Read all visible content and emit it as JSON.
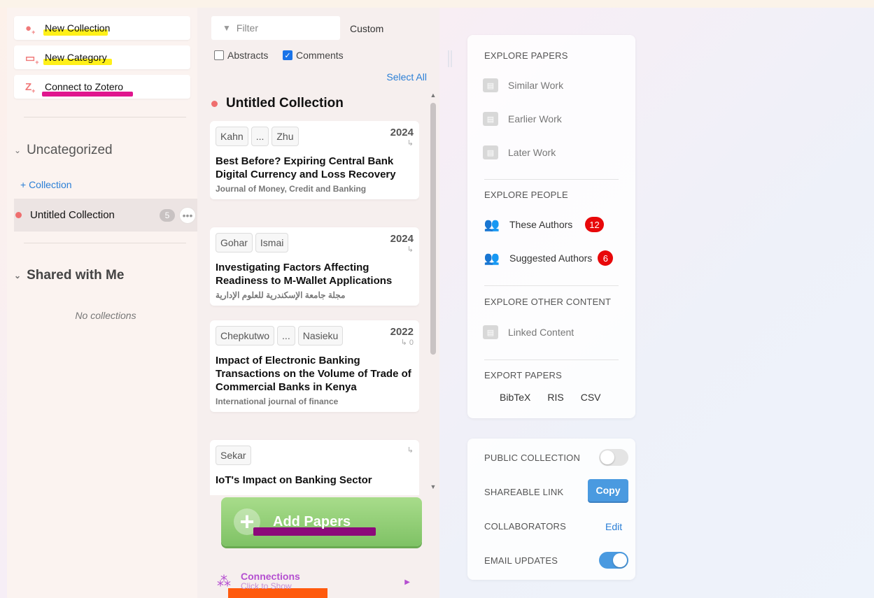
{
  "sidebar": {
    "actions": [
      {
        "label": "New Collection",
        "icon": "new-collection-icon"
      },
      {
        "label": "New Category",
        "icon": "new-category-icon"
      },
      {
        "label": "Connect to Zotero",
        "icon": "zotero-icon"
      }
    ],
    "uncategorized": "Uncategorized",
    "add_collection": "+ Collection",
    "collection": {
      "name": "Untitled Collection",
      "count": "5",
      "more": "•••"
    },
    "shared": "Shared with Me",
    "no_collections": "No collections"
  },
  "middle": {
    "filter_placeholder": "Filter",
    "sort": "Custom",
    "abstracts_label": "Abstracts",
    "comments_label": "Comments",
    "abstracts_checked": false,
    "comments_checked": true,
    "select_all": "Select All",
    "collection_title": "Untitled Collection",
    "papers": [
      {
        "authors": [
          "Kahn",
          "...",
          "Zhu"
        ],
        "year": "2024",
        "cites": "↳",
        "title": "Best Before? Expiring Central Bank Digital Currency and Loss Recovery",
        "journal": "Journal of Money, Credit and Banking"
      },
      {
        "authors": [
          "Gohar",
          "Ismai"
        ],
        "year": "2024",
        "cites": "↳",
        "title": "Investigating Factors Affecting Readiness to M-Wallet Applications",
        "journal": "مجلة جامعة الإسكندرية للعلوم الإدارية"
      },
      {
        "authors": [
          "Chepkutwo",
          "...",
          "Nasieku"
        ],
        "year": "2022",
        "cites": "↳ 0",
        "title": "Impact of Electronic Banking Transactions on the Volume of Trade of Commercial Banks in Kenya",
        "journal": "International journal of finance"
      },
      {
        "authors": [
          "Sekar"
        ],
        "year": "",
        "cites": "↳",
        "title": "IoT's Impact on Banking Sector",
        "journal": ""
      }
    ],
    "add_papers": "Add Papers",
    "connections": "Connections",
    "connections_sub": "Click to Show"
  },
  "explore": {
    "papers_head": "EXPLORE PAPERS",
    "similar": "Similar Work",
    "earlier": "Earlier Work",
    "later": "Later Work",
    "people_head": "EXPLORE PEOPLE",
    "these_authors": "These Authors",
    "these_count": "12",
    "suggested_authors": "Suggested Authors",
    "suggested_count": "6",
    "other_head": "EXPLORE OTHER CONTENT",
    "linked": "Linked Content",
    "export_head": "EXPORT PAPERS",
    "bibtex": "BibTeX",
    "ris": "RIS",
    "csv": "CSV"
  },
  "settings": {
    "public": "PUBLIC COLLECTION",
    "public_on": false,
    "shareable": "SHAREABLE LINK",
    "copy": "Copy",
    "collaborators": "COLLABORATORS",
    "edit": "Edit",
    "email": "EMAIL UPDATES",
    "email_on": true
  },
  "colors": {
    "accent": "#2b7fd6",
    "toggle_on": "#4a9ae0",
    "toggle_off": "#e4e4e4",
    "add_papers": "#8ccb6f",
    "badge": "#e8080a"
  }
}
